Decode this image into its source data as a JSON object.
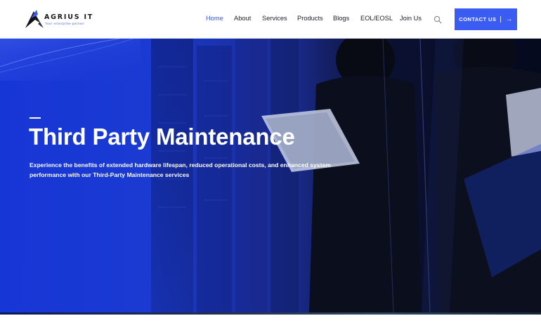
{
  "brand": {
    "name": "AGRIUS IT",
    "tagline": "Your enterprise partner",
    "logo_icon": "mountain-peak-logo"
  },
  "nav": {
    "items": [
      {
        "label": "Home",
        "active": true
      },
      {
        "label": "About",
        "active": false
      },
      {
        "label": "Services",
        "active": false
      },
      {
        "label": "Products",
        "active": false
      },
      {
        "label": "Blogs",
        "active": false
      },
      {
        "label": "EOL/EOSL",
        "active": false
      },
      {
        "label": "Join Us",
        "active": false
      }
    ],
    "search_icon": "search-icon",
    "cta": {
      "label": "CONTACT US",
      "icon": "arrow-right-icon"
    }
  },
  "hero": {
    "title": "Third Party Maintenance",
    "description": "Experience the benefits of extended hardware lifespan, reduced operational costs, and enhanced system performance with our Third-Party Maintenance services"
  },
  "colors": {
    "accent": "#3a5cf3",
    "active_nav": "#3a59f0",
    "hero_blue": "#1736d6",
    "hero_dark": "#0d1640"
  }
}
